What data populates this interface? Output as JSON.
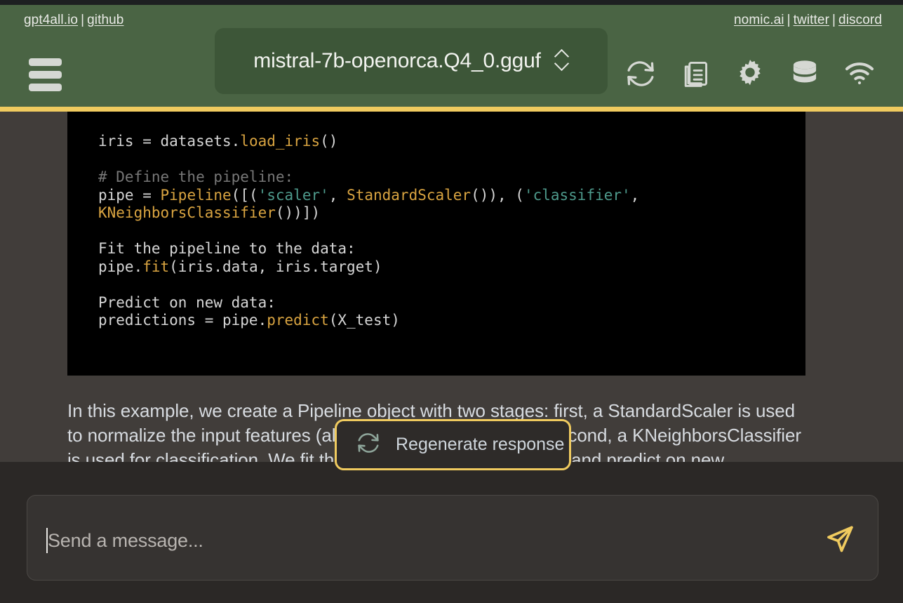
{
  "header": {
    "left_links": [
      {
        "label": "gpt4all.io",
        "name": "link-gpt4all-io"
      },
      {
        "label": "github",
        "name": "link-github"
      }
    ],
    "right_links": [
      {
        "label": "nomic.ai",
        "name": "link-nomic-ai"
      },
      {
        "label": "twitter",
        "name": "link-twitter"
      },
      {
        "label": "discord",
        "name": "link-discord"
      }
    ],
    "separator": "|",
    "model_selector": {
      "value": "mistral-7b-openorca.Q4_0.gguf",
      "icon": "chevron-up-down-icon"
    },
    "menu_icon": "hamburger-menu-icon",
    "icons": [
      {
        "name": "reset-context-icon",
        "title": "reset context"
      },
      {
        "name": "copy-chat-icon",
        "title": "copy chat"
      },
      {
        "name": "settings-gear-icon",
        "title": "settings"
      },
      {
        "name": "localdocs-database-icon",
        "title": "local docs"
      },
      {
        "name": "network-wifi-icon",
        "title": "network"
      }
    ],
    "accent_color": "#f0cb5f",
    "background_color": "#4a6444"
  },
  "chat": {
    "code_block": {
      "language": "python",
      "lines": [
        [
          {
            "t": "iris = datasets.",
            "c": "plain"
          },
          {
            "t": "load_iris",
            "c": "fn"
          },
          {
            "t": "()",
            "c": "plain"
          }
        ],
        [],
        [
          {
            "t": "# Define the pipeline:",
            "c": "comment"
          }
        ],
        [
          {
            "t": "pipe = ",
            "c": "plain"
          },
          {
            "t": "Pipeline",
            "c": "fn"
          },
          {
            "t": "([(",
            "c": "plain"
          },
          {
            "t": "'scaler'",
            "c": "str"
          },
          {
            "t": ", ",
            "c": "plain"
          },
          {
            "t": "StandardScaler",
            "c": "fn"
          },
          {
            "t": "()), (",
            "c": "plain"
          },
          {
            "t": "'classifier'",
            "c": "str"
          },
          {
            "t": ",",
            "c": "plain"
          }
        ],
        [
          {
            "t": "KNeighborsClassifier",
            "c": "fn"
          },
          {
            "t": "())])",
            "c": "plain"
          }
        ],
        [],
        [
          {
            "t": "Fit the pipeline to the data:",
            "c": "plain"
          }
        ],
        [
          {
            "t": "pipe.",
            "c": "plain"
          },
          {
            "t": "fit",
            "c": "fn"
          },
          {
            "t": "(iris.data, iris.target)",
            "c": "plain"
          }
        ],
        [],
        [
          {
            "t": "Predict on new data:",
            "c": "plain"
          }
        ],
        [
          {
            "t": "predictions = pipe.",
            "c": "plain"
          },
          {
            "t": "predict",
            "c": "fn"
          },
          {
            "t": "(X_test)",
            "c": "plain"
          }
        ]
      ]
    },
    "response_text": "In this example, we create a Pipeline object with two stages: first, a StandardScaler is used to normalize the input features (also known as scaling), and second, a KNeighborsClassifier is used for classification. We fit the pipeline to the training data and predict on new"
  },
  "regenerate": {
    "label": "Regenerate response",
    "icon": "regenerate-refresh-icon"
  },
  "composer": {
    "placeholder": "Send a message...",
    "value": "",
    "send_icon": "send-paper-plane-icon",
    "send_color": "#f0cb5f"
  }
}
